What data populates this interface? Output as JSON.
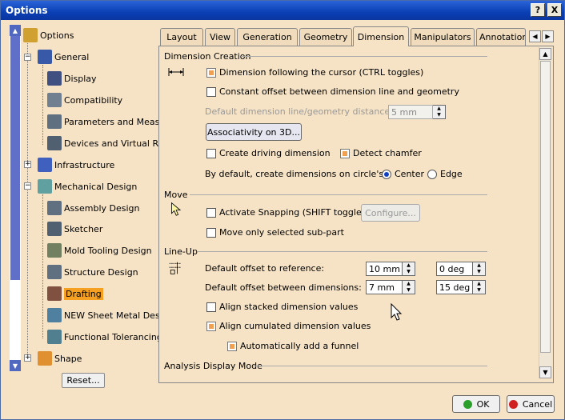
{
  "window": {
    "title": "Options",
    "help_label": "?",
    "close_label": "X"
  },
  "tree": {
    "items": [
      {
        "label": "Options",
        "icon": "options-root-icon"
      },
      {
        "label": "General",
        "icon": "general-icon"
      },
      {
        "label": "Display",
        "icon": "display-icon"
      },
      {
        "label": "Compatibility",
        "icon": "compatibility-icon"
      },
      {
        "label": "Parameters and Measure",
        "icon": "parameters-icon"
      },
      {
        "label": "Devices and Virtual Rea",
        "icon": "devices-icon"
      },
      {
        "label": "Infrastructure",
        "icon": "infrastructure-icon"
      },
      {
        "label": "Mechanical Design",
        "icon": "mechanical-design-icon"
      },
      {
        "label": "Assembly Design",
        "icon": "assembly-icon"
      },
      {
        "label": "Sketcher",
        "icon": "sketcher-icon"
      },
      {
        "label": "Mold Tooling Design",
        "icon": "mold-tooling-icon"
      },
      {
        "label": "Structure Design",
        "icon": "structure-icon"
      },
      {
        "label": "Drafting",
        "icon": "drafting-icon"
      },
      {
        "label": "NEW Sheet Metal Desig",
        "icon": "sheet-metal-icon"
      },
      {
        "label": "Functional Tolerancing",
        "icon": "tolerancing-icon"
      },
      {
        "label": "Shape",
        "icon": "shape-icon"
      }
    ],
    "selected": "Drafting",
    "reset_label": "Reset..."
  },
  "tabs": [
    "Layout",
    "View",
    "Generation",
    "Geometry",
    "Dimension",
    "Manipulators",
    "Annotation"
  ],
  "active_tab": "Dimension",
  "sections": {
    "creation": {
      "title": "Dimension Creation",
      "follow_cursor": "Dimension following the cursor (CTRL toggles)",
      "constant_offset": "Constant offset between dimension line and geometry",
      "default_distance_label": "Default dimension line/geometry distance:",
      "default_distance_value": "5 mm",
      "associativity_label": "Associativity on 3D...",
      "driving_dimension": "Create driving dimension",
      "detect_chamfer": "Detect chamfer",
      "circle_label": "By default, create dimensions on circle's",
      "center_label": "Center",
      "edge_label": "Edge"
    },
    "move": {
      "title": "Move",
      "snapping": "Activate Snapping (SHIFT toggles)",
      "configure_label": "Configure...",
      "selected_subpart": "Move only selected sub-part"
    },
    "lineup": {
      "title": "Line-Up",
      "offset_ref_label": "Default offset to reference:",
      "offset_ref_value": "10 mm",
      "offset_ref_angle": "0 deg",
      "offset_between_label": "Default offset between dimensions:",
      "offset_between_value": "7 mm",
      "offset_between_angle": "15 deg",
      "align_stacked": "Align stacked dimension values",
      "align_cumulated": "Align cumulated dimension values",
      "add_funnel": "Automatically add a funnel"
    },
    "analysis": {
      "title": "Analysis Display Mode"
    }
  },
  "footer": {
    "ok_label": "OK",
    "cancel_label": "Cancel"
  },
  "colors": {
    "accent": "#0a3fb4",
    "panel": "#f6e3c6",
    "selected": "#f5a020"
  }
}
